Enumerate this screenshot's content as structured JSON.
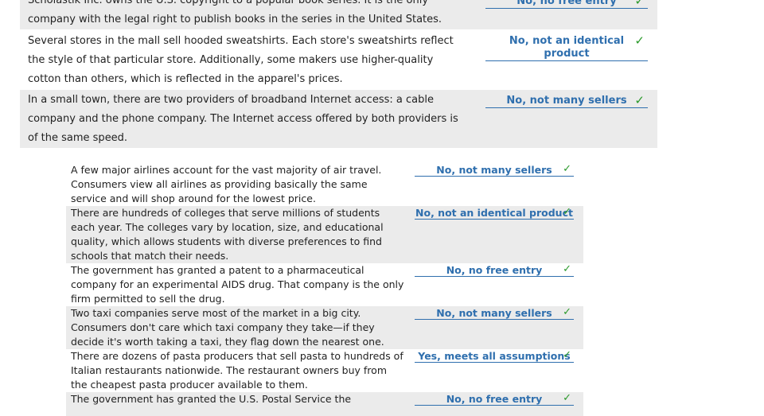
{
  "top_table": [
    {
      "question": "Scholastik Inc. owns the U.S. copyright to a popular book series. It is the only company with the legal right to publish books in the series in the United States.",
      "answer": "No, no free entry",
      "check": "✓",
      "shaded": true
    },
    {
      "question": "Several stores in the mall sell hooded sweatshirts. Each store's sweatshirts reflect the style of that particular store. Additionally, some makers use higher-quality cotton than others, which is reflected in the apparel's prices.",
      "answer": "No, not an identical product",
      "check": "✓",
      "shaded": false
    },
    {
      "question": "In a small town, there are two providers of broadband Internet access: a cable company and the phone company. The Internet access offered by both providers is of the same speed.",
      "answer": "No, not many sellers",
      "check": "✓",
      "shaded": true
    }
  ],
  "bottom_table": [
    {
      "question": "A few major airlines account for the vast majority of air travel. Consumers view all airlines as providing basically the same service and will shop around for the lowest price.",
      "answer": "No, not many sellers",
      "check": "✓",
      "shaded": false
    },
    {
      "question": "There are hundreds of colleges that serve millions of students each year. The colleges vary by location, size, and educational quality, which allows students with diverse preferences to find schools that match their needs.",
      "answer": "No, not an identical product",
      "check": "✓",
      "shaded": true
    },
    {
      "question": "The government has granted a patent to a pharmaceutical company for an experimental AIDS drug. That company is the only firm permitted to sell the drug.",
      "answer": "No, no free entry",
      "check": "✓",
      "shaded": false
    },
    {
      "question": "Two taxi companies serve most of the market in a big city. Consumers don't care which taxi company they take—if they decide it's worth taking a taxi, they flag down the nearest one.",
      "answer": "No, not many sellers",
      "check": "✓",
      "shaded": true
    },
    {
      "question": "There are dozens of pasta producers that sell pasta to hundreds of Italian restaurants nationwide. The restaurant owners buy from the cheapest pasta producer available to them.",
      "answer": "Yes, meets all assumptions",
      "check": "✓",
      "shaded": false
    },
    {
      "question": "The government has granted the U.S. Postal Service the",
      "answer": "No, no free entry",
      "check": "✓",
      "shaded": true
    }
  ]
}
